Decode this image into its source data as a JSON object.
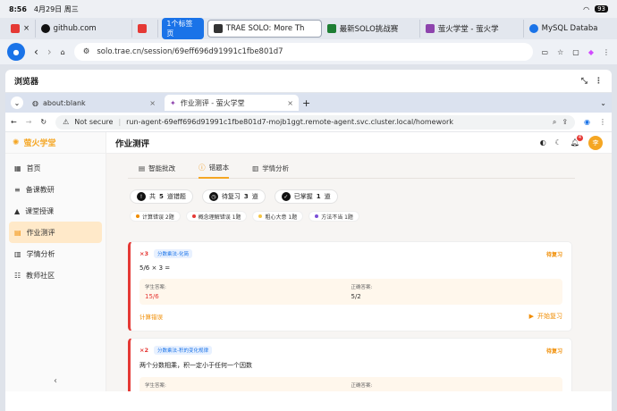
{
  "status_bar": {
    "time": "8:56",
    "date": "4月29日 周三",
    "battery": "93"
  },
  "outer_tabs": [
    {
      "label": "",
      "color": "#e53935"
    },
    {
      "label": "github.com",
      "color": "#111111"
    },
    {
      "label": "",
      "color": "#e53935"
    },
    {
      "group_label": "1个标签页"
    },
    {
      "label": "TRAE SOLO: More Th",
      "color": "#333333"
    },
    {
      "label": "最新SOLO挑战赛",
      "color": "#1e7e34"
    },
    {
      "label": "萤火学堂 - 萤火学",
      "color": "#8e44ad"
    },
    {
      "label": "MySQL Databa",
      "color": "#1a73e8"
    }
  ],
  "outer_url": "solo.trae.cn/session/69eff696d91991c1fbe801d7",
  "panel_title": "浏览器",
  "inner_tabs": [
    {
      "label": "about:blank"
    },
    {
      "label": "作业测评 - 萤火学堂"
    }
  ],
  "inner_url": {
    "secure_label": "Not secure",
    "url": "run-agent-69eff696d91991c1fbe801d7-mojb1ggt.remote-agent.svc.cluster.local/homework"
  },
  "app": {
    "brand": "萤火学堂",
    "page_title": "作业测评",
    "avatar": "李",
    "notif_count": "4",
    "sidebar": [
      {
        "label": "首页"
      },
      {
        "label": "备课教研"
      },
      {
        "label": "课堂授课"
      },
      {
        "label": "作业测评"
      },
      {
        "label": "学情分析"
      },
      {
        "label": "教师社区"
      }
    ],
    "subtabs": [
      {
        "label": "智能批改"
      },
      {
        "label": "错题本"
      },
      {
        "label": "学情分析"
      }
    ],
    "stats": [
      {
        "prefix": "共",
        "num": "5",
        "suffix": "道错题"
      },
      {
        "prefix": "待复习",
        "num": "3",
        "suffix": "道"
      },
      {
        "prefix": "已掌握",
        "num": "1",
        "suffix": "道"
      }
    ],
    "tags": [
      {
        "label": "计算错误 2题",
        "color": "#f08c00"
      },
      {
        "label": "概念理解错误 1题",
        "color": "#e53935"
      },
      {
        "label": "粗心大意 1题",
        "color": "#f5c542"
      },
      {
        "label": "方法不当 1题",
        "color": "#7b4fd6"
      }
    ],
    "cards": [
      {
        "count": "×3",
        "knowledge": "分数乘法-化简",
        "status": "待复习",
        "question": "5/6 × 3 =",
        "student_label": "学生答案:",
        "student_answer": "15/6",
        "correct_label": "正确答案:",
        "correct_answer": "5/2",
        "reason": "计算错误",
        "action": "开始复习"
      },
      {
        "count": "×2",
        "knowledge": "分数乘法-积的变化规律",
        "status": "待复习",
        "question": "两个分数相乘，积一定小于任何一个因数",
        "student_label": "学生答案:",
        "student_answer": "对",
        "correct_label": "正确答案:",
        "correct_answer": "错"
      }
    ]
  }
}
